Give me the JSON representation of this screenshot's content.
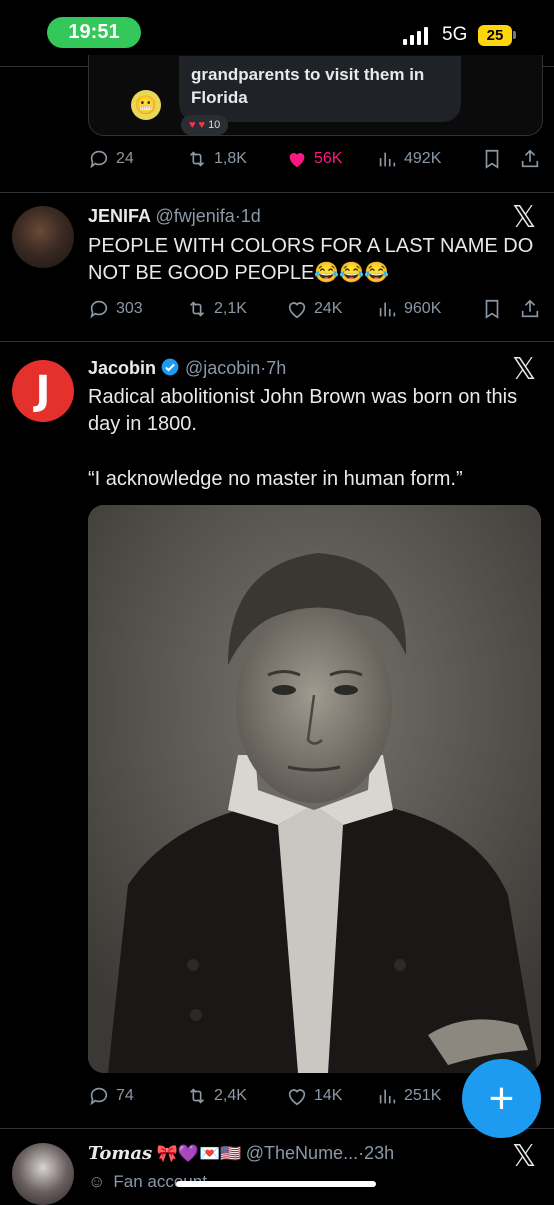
{
  "status": {
    "time": "19:51",
    "network": "5G",
    "battery": "25"
  },
  "quoted": {
    "text_line1": "grandparents to visit them in",
    "text_line2": "Florida",
    "reaction_count": "10"
  },
  "tweet0_actions": {
    "replies": "24",
    "retweets": "1,8K",
    "likes": "56K",
    "views": "492K"
  },
  "tweet1": {
    "name": "JENIFA",
    "handle": "@fwjenifa",
    "time": "1d",
    "text": "PEOPLE WITH COLORS FOR A LAST NAME DO NOT BE GOOD PEOPLE😂😂😂",
    "replies": "303",
    "retweets": "2,1K",
    "likes": "24K",
    "views": "960K"
  },
  "tweet2": {
    "name": "Jacobin",
    "handle": "@jacobin",
    "time": "7h",
    "logo_letter": "J",
    "text1": "Radical abolitionist John Brown was born on this day in 1800.",
    "text2": "“I acknowledge no master in human form.”",
    "replies": "74",
    "retweets": "2,4K",
    "likes": "14K",
    "views": "251K"
  },
  "tweet3": {
    "name": "Tomas",
    "emojis": "🎀💜💌🇺🇸",
    "handle": "@TheNume...",
    "time": "23h",
    "label": "Fan account"
  },
  "icons": [
    "reply-icon",
    "retweet-icon",
    "like-icon",
    "views-icon",
    "bookmark-icon",
    "share-icon",
    "x-logo-icon",
    "verified-icon",
    "compose-icon"
  ],
  "colors": {
    "accent": "#1d9bf0",
    "like": "#f91880",
    "status_green": "#34c759",
    "jacobin_red": "#e4312b"
  }
}
